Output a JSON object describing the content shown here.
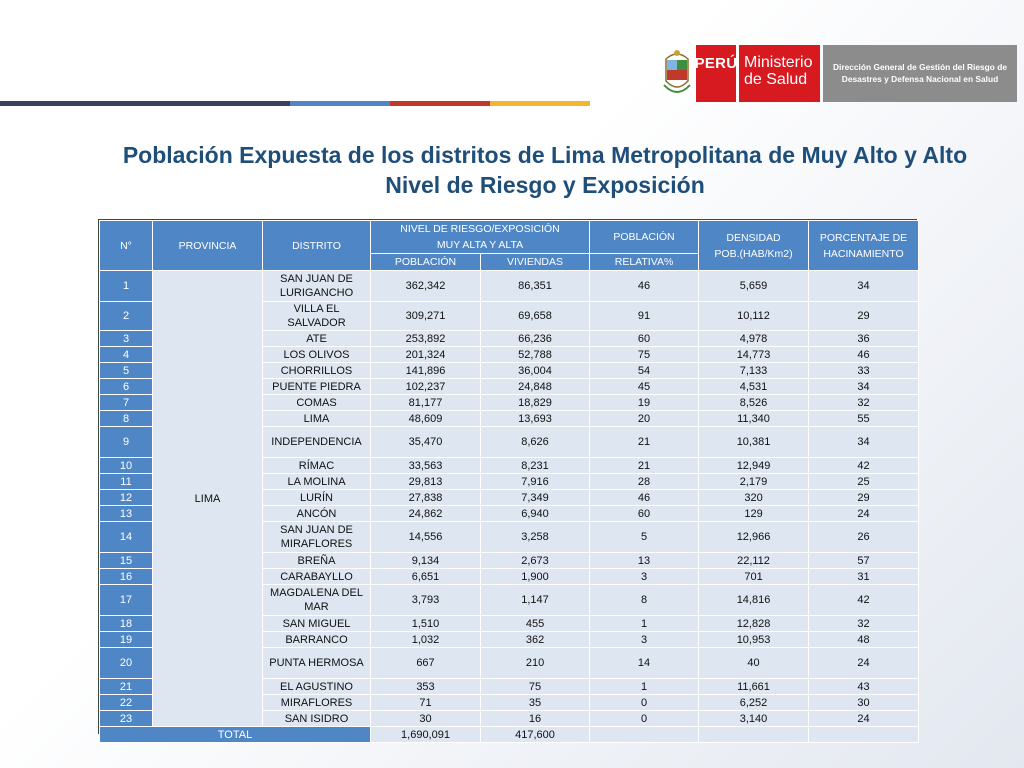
{
  "header": {
    "peru_label": "PERÚ",
    "ministry_line1": "Ministerio",
    "ministry_line2": "de Salud",
    "directorate": "Dirección General de Gestión del Riesgo de Desastres y Defensa Nacional en Salud"
  },
  "colors": {
    "title": "#1f4e79",
    "header_blue": "#4f86c6",
    "cell_bg": "#dde6f1",
    "brand_red": "#d71920",
    "gray_box": "#8c8c8c",
    "bar": [
      "#3a3f5c",
      "#4f86c6",
      "#c0392b",
      "#f2b630"
    ]
  },
  "title": {
    "line1": "Población Expuesta de los distritos de Lima Metropolitana de Muy Alto y Alto",
    "line2": "Nivel de Riesgo y Exposición"
  },
  "table": {
    "headers": {
      "n": "N°",
      "provincia": "PROVINCIA",
      "distrito": "DISTRITO",
      "nivel_line1": "NIVEL DE RIESGO/EXPOSICIÓN",
      "nivel_line2": "MUY ALTA Y ALTA",
      "poblacion_sub": "POBLACIÓN",
      "viviendas_sub": "VIVIENDAS",
      "poblacion": "POBLACIÓN",
      "relativa": "RELATIVA%",
      "densidad_line1": "DENSIDAD",
      "densidad_line2": "POB.(HAB/Km2)",
      "porcentaje_line1": "PORCENTAJE DE",
      "porcentaje_line2": "HACINAMIENTO"
    },
    "provincia": "LIMA",
    "rows": [
      {
        "n": "1",
        "distrito": "SAN JUAN DE LURIGANCHO",
        "poblacion": "362,342",
        "viviendas": "86,351",
        "relativa": "46",
        "densidad": "5,659",
        "hacinamiento": "34"
      },
      {
        "n": "2",
        "distrito": "VILLA EL SALVADOR",
        "poblacion": "309,271",
        "viviendas": "69,658",
        "relativa": "91",
        "densidad": "10,112",
        "hacinamiento": "29"
      },
      {
        "n": "3",
        "distrito": "ATE",
        "poblacion": "253,892",
        "viviendas": "66,236",
        "relativa": "60",
        "densidad": "4,978",
        "hacinamiento": "36"
      },
      {
        "n": "4",
        "distrito": "LOS OLIVOS",
        "poblacion": "201,324",
        "viviendas": "52,788",
        "relativa": "75",
        "densidad": "14,773",
        "hacinamiento": "46"
      },
      {
        "n": "5",
        "distrito": "CHORRILLOS",
        "poblacion": "141,896",
        "viviendas": "36,004",
        "relativa": "54",
        "densidad": "7,133",
        "hacinamiento": "33"
      },
      {
        "n": "6",
        "distrito": "PUENTE PIEDRA",
        "poblacion": "102,237",
        "viviendas": "24,848",
        "relativa": "45",
        "densidad": "4,531",
        "hacinamiento": "34"
      },
      {
        "n": "7",
        "distrito": "COMAS",
        "poblacion": "81,177",
        "viviendas": "18,829",
        "relativa": "19",
        "densidad": "8,526",
        "hacinamiento": "32"
      },
      {
        "n": "8",
        "distrito": "LIMA",
        "poblacion": "48,609",
        "viviendas": "13,693",
        "relativa": "20",
        "densidad": "11,340",
        "hacinamiento": "55"
      },
      {
        "n": "9",
        "distrito": "INDEPENDENCIA",
        "poblacion": "35,470",
        "viviendas": "8,626",
        "relativa": "21",
        "densidad": "10,381",
        "hacinamiento": "34"
      },
      {
        "n": "10",
        "distrito": "RÍMAC",
        "poblacion": "33,563",
        "viviendas": "8,231",
        "relativa": "21",
        "densidad": "12,949",
        "hacinamiento": "42"
      },
      {
        "n": "11",
        "distrito": "LA MOLINA",
        "poblacion": "29,813",
        "viviendas": "7,916",
        "relativa": "28",
        "densidad": "2,179",
        "hacinamiento": "25"
      },
      {
        "n": "12",
        "distrito": "LURÍN",
        "poblacion": "27,838",
        "viviendas": "7,349",
        "relativa": "46",
        "densidad": "320",
        "hacinamiento": "29"
      },
      {
        "n": "13",
        "distrito": "ANCÓN",
        "poblacion": "24,862",
        "viviendas": "6,940",
        "relativa": "60",
        "densidad": "129",
        "hacinamiento": "24"
      },
      {
        "n": "14",
        "distrito": "SAN JUAN DE MIRAFLORES",
        "poblacion": "14,556",
        "viviendas": "3,258",
        "relativa": "5",
        "densidad": "12,966",
        "hacinamiento": "26"
      },
      {
        "n": "15",
        "distrito": "BREÑA",
        "poblacion": "9,134",
        "viviendas": "2,673",
        "relativa": "13",
        "densidad": "22,112",
        "hacinamiento": "57"
      },
      {
        "n": "16",
        "distrito": "CARABAYLLO",
        "poblacion": "6,651",
        "viviendas": "1,900",
        "relativa": "3",
        "densidad": "701",
        "hacinamiento": "31"
      },
      {
        "n": "17",
        "distrito": "MAGDALENA DEL MAR",
        "poblacion": "3,793",
        "viviendas": "1,147",
        "relativa": "8",
        "densidad": "14,816",
        "hacinamiento": "42"
      },
      {
        "n": "18",
        "distrito": "SAN MIGUEL",
        "poblacion": "1,510",
        "viviendas": "455",
        "relativa": "1",
        "densidad": "12,828",
        "hacinamiento": "32"
      },
      {
        "n": "19",
        "distrito": "BARRANCO",
        "poblacion": "1,032",
        "viviendas": "362",
        "relativa": "3",
        "densidad": "10,953",
        "hacinamiento": "48"
      },
      {
        "n": "20",
        "distrito": "PUNTA HERMOSA",
        "poblacion": "667",
        "viviendas": "210",
        "relativa": "14",
        "densidad": "40",
        "hacinamiento": "24"
      },
      {
        "n": "21",
        "distrito": "EL AGUSTINO",
        "poblacion": "353",
        "viviendas": "75",
        "relativa": "1",
        "densidad": "11,661",
        "hacinamiento": "43"
      },
      {
        "n": "22",
        "distrito": "MIRAFLORES",
        "poblacion": "71",
        "viviendas": "35",
        "relativa": "0",
        "densidad": "6,252",
        "hacinamiento": "30"
      },
      {
        "n": "23",
        "distrito": "SAN ISIDRO",
        "poblacion": "30",
        "viviendas": "16",
        "relativa": "0",
        "densidad": "3,140",
        "hacinamiento": "24"
      }
    ],
    "total": {
      "label": "TOTAL",
      "poblacion": "1,690,091",
      "viviendas": "417,600"
    }
  }
}
